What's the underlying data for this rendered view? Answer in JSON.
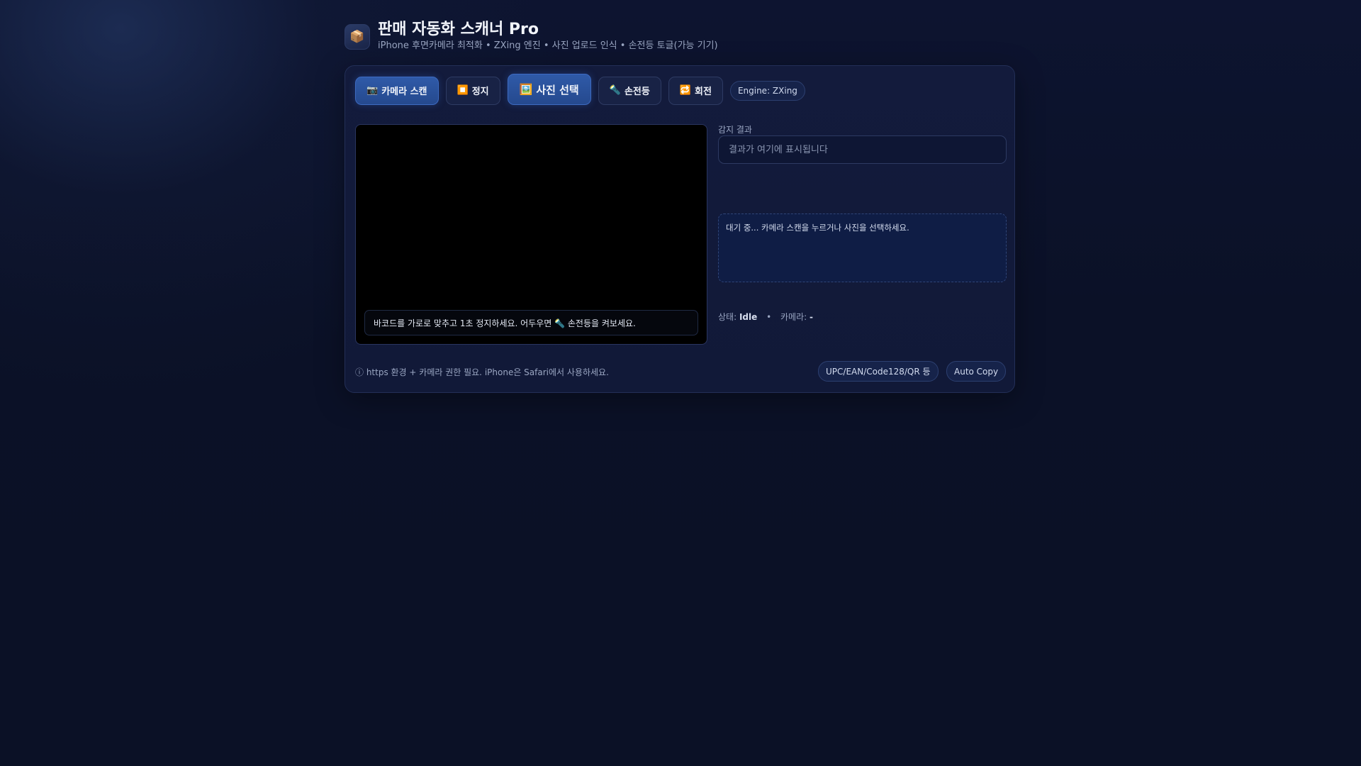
{
  "header": {
    "logo_icon": "📦",
    "logo_icon_name": "package-icon",
    "title": "판매 자동화 스캐너 Pro",
    "subtitle": "iPhone 후면카메라 최적화 • ZXing 엔진 • 사진 업로드 인식 • 손전등 토글(가능 기기)"
  },
  "toolbar": {
    "camera_scan": {
      "icon": "📷",
      "label": "카메라 스캔"
    },
    "stop": {
      "icon": "⏹️",
      "label": "정지"
    },
    "photo_select": {
      "icon": "🖼️",
      "label": "사진 선택"
    },
    "torch": {
      "icon": "🔦",
      "label": "손전등"
    },
    "rotate": {
      "icon": "🔁",
      "label": "회전"
    },
    "engine": "Engine: ZXing"
  },
  "video": {
    "hint": "바코드를 가로로 맞추고 1초 정지하세요. 어두우면 🔦 손전등을 켜보세요."
  },
  "result": {
    "label": "감지 결과",
    "placeholder": "결과가 여기에 표시됩니다",
    "value": ""
  },
  "log": {
    "text": "대기 중... 카메라 스캔을 누르거나 사진을 선택하세요."
  },
  "status": {
    "state_label": "상태:",
    "state_value": "Idle",
    "separator": "•",
    "camera_label": "카메라:",
    "camera_value": "-"
  },
  "footer": {
    "note": "ⓘ https 환경 + 카메라 권한 필요. iPhone은 Safari에서 사용하세요.",
    "formats": "UPC/EAN/Code128/QR 등",
    "auto_copy": "Auto Copy"
  },
  "colors": {
    "background": "#0b1126",
    "card": "#131b3c",
    "primary": "#2f5aa8",
    "text_muted": "#9aa6c2"
  }
}
